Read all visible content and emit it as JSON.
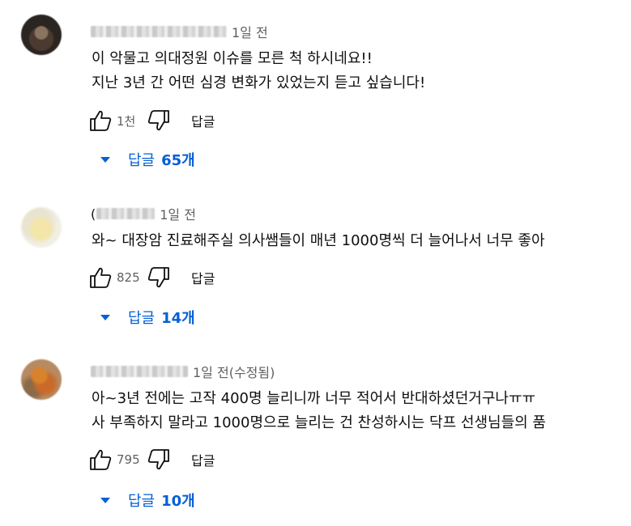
{
  "comments": [
    {
      "time": "1일 전",
      "name_prefix": "",
      "lines": [
        "이 악물고 의대정원 이슈를 모른 척 하시네요!!",
        "지난 3년 간 어떤 심경 변화가 있었는지 듣고 싶습니다!"
      ],
      "likes": "1천",
      "reply_label": "답글",
      "replies_label": "답글",
      "replies_count": "65개"
    },
    {
      "time": "1일 전",
      "name_prefix": "(",
      "lines": [
        "와~ 대장암 진료해주실 의사쌤들이 매년 1000명씩 더 늘어나서 너무 좋아"
      ],
      "likes": "825",
      "reply_label": "답글",
      "replies_label": "답글",
      "replies_count": "14개"
    },
    {
      "time": "1일 전(수정됨)",
      "name_prefix": "",
      "lines": [
        "아~3년 전에는 고작 400명 늘리니까 너무 적어서 반대하셨던거구나ㅠㅠ",
        "사 부족하지 말라고 1000명으로 늘리는 건 찬성하시는 닥프 선생님들의 품"
      ],
      "likes": "795",
      "reply_label": "답글",
      "replies_label": "답글",
      "replies_count": "10개"
    }
  ],
  "icons": {
    "like": "thumbs-up-icon",
    "dislike": "thumbs-down-icon",
    "expand": "caret-down-icon"
  },
  "colors": {
    "link": "#065fd4",
    "meta": "#606060",
    "text": "#0f0f0f"
  }
}
